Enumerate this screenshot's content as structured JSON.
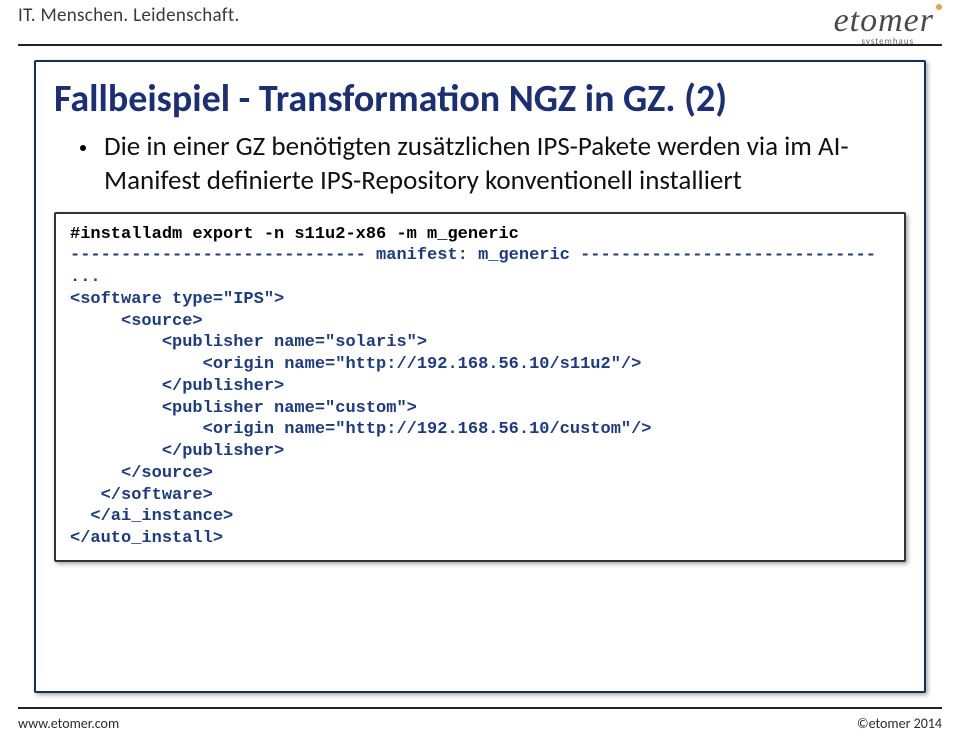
{
  "header": {
    "tagline": "IT. Menschen. Leidenschaft.",
    "logo_word": "etomer",
    "logo_sub": "systemhaus"
  },
  "slide": {
    "title": "Fallbeispiel - Transformation NGZ in GZ. (2)",
    "bullet": "Die in einer GZ benötigten zusätzlichen IPS-Pakete werden via im AI-Manifest definierte IPS-Repository konventionell installiert",
    "code_cmd": "#installadm export -n s11u2-x86 -m m_generic",
    "code_body": "----------------------------- manifest: m_generic -----------------------------\n...\n<software type=\"IPS\">\n     <source>\n         <publisher name=\"solaris\">\n             <origin name=\"http://192.168.56.10/s11u2\"/>\n         </publisher>\n         <publisher name=\"custom\">\n             <origin name=\"http://192.168.56.10/custom\"/>\n         </publisher>\n     </source>\n   </software>\n  </ai_instance>\n</auto_install>"
  },
  "footer": {
    "left": "www.etomer.com",
    "right": "©etomer 2014"
  }
}
